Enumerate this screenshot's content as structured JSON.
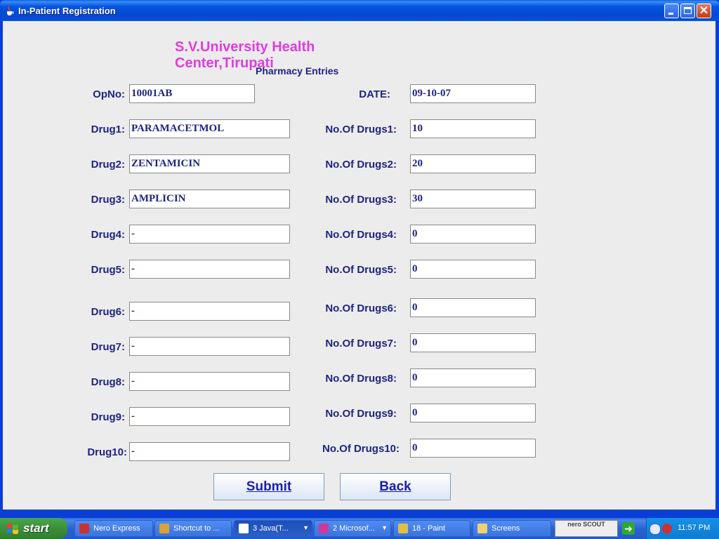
{
  "window": {
    "title": "In-Patient Registration"
  },
  "form": {
    "heading": "S.V.University Health Center,Tirupati",
    "subheading": "Pharmacy Entries",
    "opno_label": "OpNo:",
    "opno_value": "10001AB",
    "date_label": "DATE:",
    "date_value": "09-10-07",
    "drugs": [
      {
        "label": "Drug1:",
        "value": "PARAMACETMOL",
        "count_label": "No.Of Drugs1:",
        "count": "10"
      },
      {
        "label": "Drug2:",
        "value": "ZENTAMICIN",
        "count_label": "No.Of Drugs2:",
        "count": "20"
      },
      {
        "label": "Drug3:",
        "value": "AMPLICIN",
        "count_label": "No.Of Drugs3:",
        "count": "30"
      },
      {
        "label": "Drug4:",
        "value": "-",
        "count_label": "No.Of Drugs4:",
        "count": "0"
      },
      {
        "label": "Drug5:",
        "value": "-",
        "count_label": "No.Of Drugs5:",
        "count": "0"
      },
      {
        "label": "Drug6:",
        "value": "-",
        "count_label": "No.Of Drugs6:",
        "count": "0"
      },
      {
        "label": "Drug7:",
        "value": "-",
        "count_label": "No.Of Drugs7:",
        "count": "0"
      },
      {
        "label": "Drug8:",
        "value": "-",
        "count_label": "No.Of Drugs8:",
        "count": "0"
      },
      {
        "label": "Drug9:",
        "value": "-",
        "count_label": "No.Of Drugs9:",
        "count": "0"
      },
      {
        "label": "Drug10:",
        "value": "-",
        "count_label": "No.Of Drugs10:",
        "count": "0"
      }
    ],
    "submit_label": "Submit",
    "back_label": "Back"
  },
  "taskbar": {
    "start_label": "start",
    "tasks": [
      {
        "label": "Nero Express",
        "icon": "nero-icon",
        "color": "#c83232"
      },
      {
        "label": "Shortcut to ...",
        "icon": "shortcut-icon",
        "color": "#d8a23a"
      },
      {
        "label": "3 Java(T...",
        "icon": "java-window-icon",
        "color": "#ffffff"
      },
      {
        "label": "2 Microsof...",
        "icon": "word-icon",
        "color": "#cc3b9b"
      },
      {
        "label": "18 - Paint",
        "icon": "paint-icon",
        "color": "#e0c040"
      },
      {
        "label": "Screens",
        "icon": "folder-icon",
        "color": "#f0d070"
      }
    ],
    "nero_scout": "nero SCOUT",
    "clock": "11:57 PM"
  }
}
